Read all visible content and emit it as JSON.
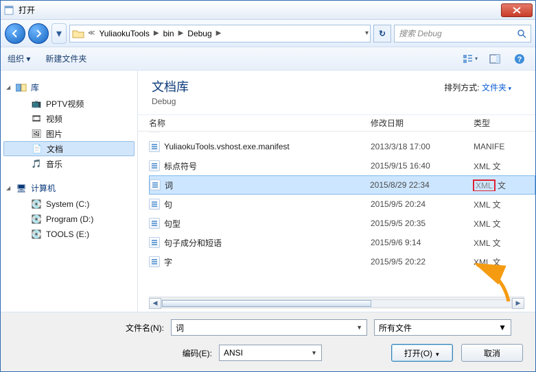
{
  "window": {
    "title": "打开"
  },
  "nav": {
    "breadcrumb": [
      "YuliaokuTools",
      "bin",
      "Debug"
    ],
    "search_placeholder": "搜索 Debug"
  },
  "toolbar": {
    "organize": "组织",
    "new_folder": "新建文件夹"
  },
  "sidebar": {
    "libraries": {
      "label": "库",
      "items": [
        {
          "label": "PPTV视频"
        },
        {
          "label": "视频"
        },
        {
          "label": "图片"
        },
        {
          "label": "文档",
          "selected": true
        },
        {
          "label": "音乐"
        }
      ]
    },
    "computer": {
      "label": "计算机",
      "items": [
        {
          "label": "System (C:)"
        },
        {
          "label": "Program (D:)"
        },
        {
          "label": "TOOLS (E:)"
        }
      ]
    }
  },
  "library_header": {
    "title": "文档库",
    "subtitle": "Debug",
    "sort_label": "排列方式:",
    "sort_value": "文件夹"
  },
  "columns": {
    "name": "名称",
    "date": "修改日期",
    "type": "类型"
  },
  "files": [
    {
      "name": "YuliaokuTools.vshost.exe.manifest",
      "date": "2013/3/18 17:00",
      "type": "MANIFE"
    },
    {
      "name": "标点符号",
      "date": "2015/9/15 16:40",
      "type": "XML 文"
    },
    {
      "name": "词",
      "date": "2015/8/29 22:34",
      "type": "XML 文",
      "selected": true,
      "type_hl": "XML"
    },
    {
      "name": "句",
      "date": "2015/9/5 20:24",
      "type": "XML 文"
    },
    {
      "name": "句型",
      "date": "2015/9/5 20:35",
      "type": "XML 文"
    },
    {
      "name": "句子成分和短语",
      "date": "2015/9/6 9:14",
      "type": "XML 文"
    },
    {
      "name": "字",
      "date": "2015/9/5 20:22",
      "type": "XML 文"
    }
  ],
  "footer": {
    "filename_label": "文件名(N):",
    "filename_value": "词",
    "filter_value": "所有文件",
    "encoding_label": "编码(E):",
    "encoding_value": "ANSI",
    "open_btn": "打开(O)",
    "cancel_btn": "取消"
  }
}
